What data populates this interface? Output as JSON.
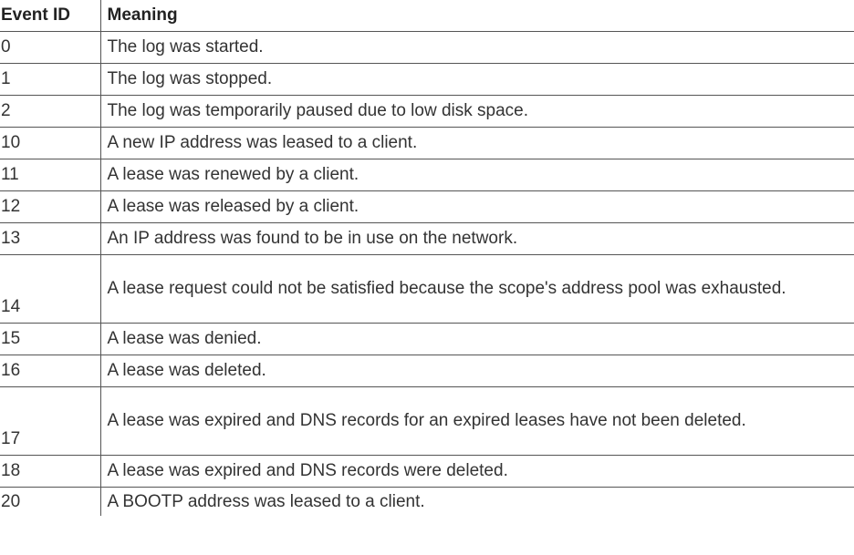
{
  "table": {
    "headers": {
      "event_id": "Event ID",
      "meaning": "Meaning"
    },
    "rows": [
      {
        "id": "0",
        "meaning": "The log was started."
      },
      {
        "id": "1",
        "meaning": "The log was stopped."
      },
      {
        "id": "2",
        "meaning": "The log was temporarily paused due to low disk space."
      },
      {
        "id": "10",
        "meaning": "A new IP address was leased to a client."
      },
      {
        "id": "11",
        "meaning": "A lease was renewed by a client."
      },
      {
        "id": "12",
        "meaning": "A lease was released by a client."
      },
      {
        "id": "13",
        "meaning": "An IP address was found to be in use on the network."
      },
      {
        "id": "14",
        "meaning": "A lease request could not be satisfied because the scope's address pool was exhausted."
      },
      {
        "id": "15",
        "meaning": "A lease was denied."
      },
      {
        "id": "16",
        "meaning": "A lease was deleted."
      },
      {
        "id": "17",
        "meaning": "A lease was expired and DNS records for an expired leases have not been deleted."
      },
      {
        "id": "18",
        "meaning": "A lease was expired and DNS records were deleted."
      },
      {
        "id": "20",
        "meaning": "A BOOTP address was leased to a client."
      }
    ]
  }
}
